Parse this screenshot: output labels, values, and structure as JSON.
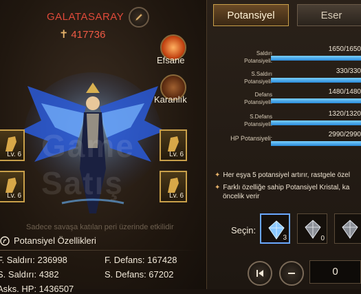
{
  "header": {
    "player_name": "GALATASARAY",
    "power_value": "417736"
  },
  "side_buttons": {
    "efsane": "Efsane",
    "karanlik": "Karanlık"
  },
  "equipment": [
    {
      "level": "Lv. 6"
    },
    {
      "level": "Lv. 6"
    },
    {
      "level": "Lv. 6"
    },
    {
      "level": "Lv. 6"
    }
  ],
  "watermark": "Game Satış",
  "note": "Sadece savaşa katılan peri üzerinde etkilidir",
  "section_title": "Potansiyel Özellikleri",
  "stats": {
    "attack": "F. Saldırı: 236998",
    "defense": "F. Defans: 167428",
    "s_attack": "S. Saldırı: 4382",
    "s_defense": "S. Defans: 67202",
    "hp_partial": "Asks. HP: 1436507"
  },
  "tabs": {
    "active": "Potansiyel",
    "inactive": "Eser"
  },
  "potential_bars": [
    {
      "label": "Saldırı Potansiyeli:",
      "value": "1650/1650",
      "fill": 1.0
    },
    {
      "label": "S.Saldırı Potansiyeli:",
      "value": "330/330",
      "fill": 1.0
    },
    {
      "label": "Defans Potansiyeli:",
      "value": "1480/1480",
      "fill": 1.0
    },
    {
      "label": "S.Defans Potansiyeli:",
      "value": "1320/1320",
      "fill": 1.0
    },
    {
      "label": "HP Potansiyeli:",
      "value": "2990/2990",
      "fill": 1.0
    }
  ],
  "info": {
    "line1": "Her eşya 5 potansiyel artırır, rastgele özel",
    "line2": "Farklı özelliğe sahip Potansiyel Kristal, ka",
    "line3": "öncelik verir"
  },
  "select": {
    "label": "Seçin:",
    "crystals": [
      {
        "count": "3",
        "icon": "blue-crystal-icon"
      },
      {
        "count": "0",
        "icon": "silver-crystal-icon"
      },
      {
        "count": "",
        "icon": "silver-crystal-icon"
      }
    ]
  },
  "quantity": "0",
  "colors": {
    "accent_gold": "#c9a04a",
    "bar_blue": "#3ea8f0",
    "name_red": "#e04a3a"
  }
}
